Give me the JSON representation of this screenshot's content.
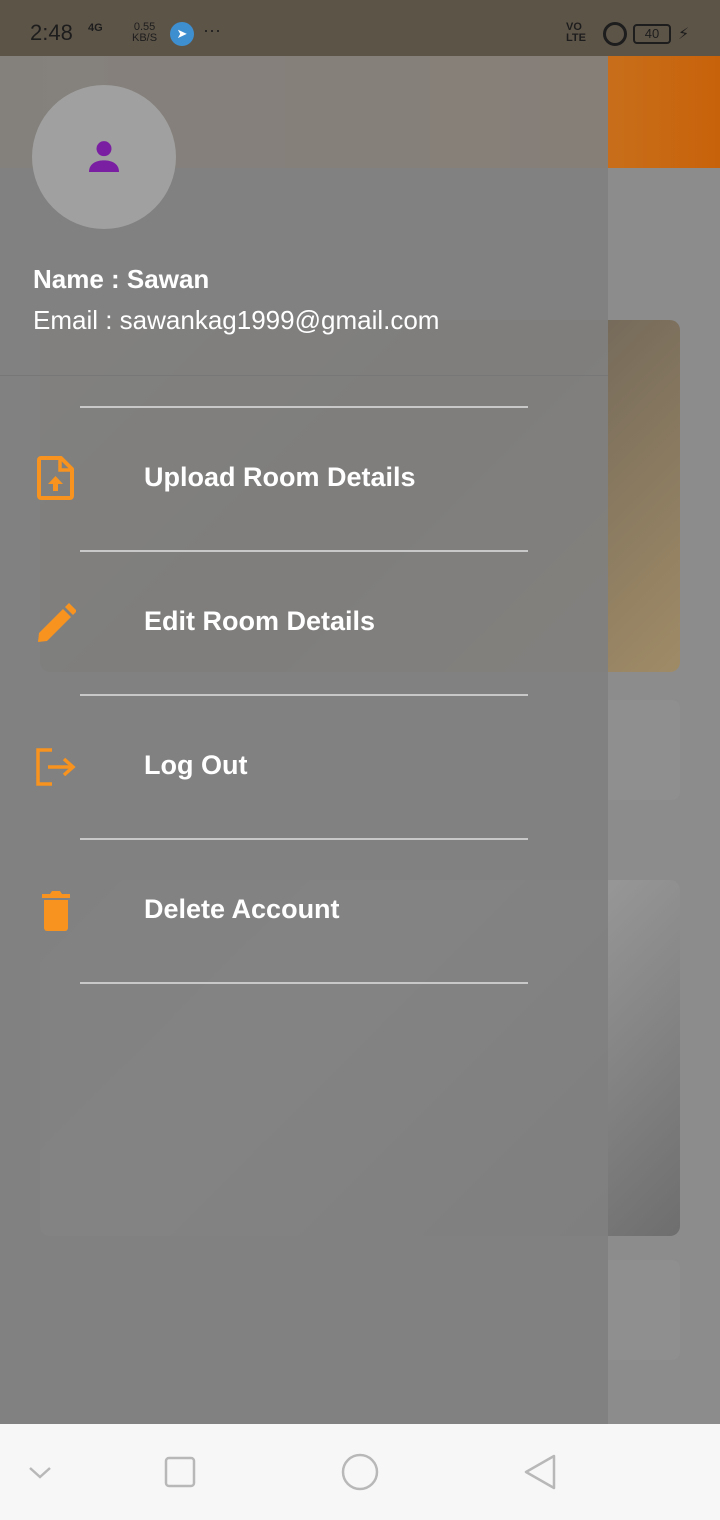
{
  "status_bar": {
    "time": "2:48",
    "network": "4G",
    "speed_value": "0.55",
    "speed_unit": "KB/S",
    "app_icon": "telegram-icon",
    "more": "···",
    "volte_top": "VO",
    "volte_bottom": "LTE",
    "battery": "40"
  },
  "drawer": {
    "avatar_icon": "person-icon",
    "name_line": "Name  : Sawan",
    "email_line": "Email  : sawankag1999@gmail.com",
    "items": [
      {
        "label": "Upload Room Details",
        "icon": "upload-file-icon"
      },
      {
        "label": "Edit Room Details",
        "icon": "pencil-icon"
      },
      {
        "label": "Log Out",
        "icon": "logout-icon"
      },
      {
        "label": "Delete Account",
        "icon": "trash-icon"
      }
    ]
  },
  "navigation_bar": {
    "buttons": [
      "chevron-down-icon",
      "square-recents-icon",
      "circle-home-icon",
      "triangle-back-icon"
    ]
  },
  "colors": {
    "accent": "#F7931E",
    "avatar_icon": "#7B1FA2",
    "appbar": "#C8620A"
  }
}
